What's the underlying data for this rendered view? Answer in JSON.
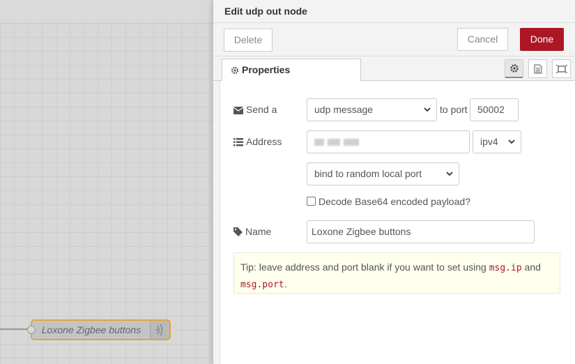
{
  "workspace": {
    "node_label": "Loxone Zigbee buttons",
    "node_icon": "udp-out-icon"
  },
  "tray": {
    "title": "Edit udp out node",
    "delete_label": "Delete",
    "cancel_label": "Cancel",
    "done_label": "Done",
    "tab_properties": "Properties",
    "tab_icons": [
      "gear-icon",
      "description-icon",
      "appearance-icon"
    ]
  },
  "form": {
    "send_label": "Send a",
    "send_value": "udp message",
    "to_port_label": "to port",
    "port_value": "50002",
    "address_label": "Address",
    "address_value": "",
    "ip_version_value": "ipv4",
    "bind_value": "bind to random local port",
    "base64_label": "Decode Base64 encoded payload?",
    "base64_checked": false,
    "name_label": "Name",
    "name_value": "Loxone Zigbee buttons"
  },
  "tip": {
    "prefix": "Tip: leave address and port blank if you want to set using",
    "code1": "msg.ip",
    "and_text": "and",
    "code2": "msg.port",
    "suffix": "."
  },
  "colors": {
    "done_button": "#ad1625",
    "node_border": "#e8a23a",
    "tip_background": "#ffffee"
  }
}
